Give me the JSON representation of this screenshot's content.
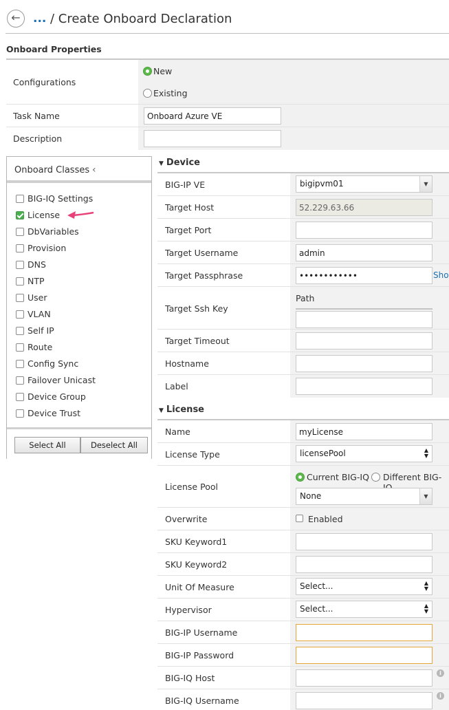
{
  "header": {
    "breadcrumb_ellipsis": "...",
    "title": "/ Create Onboard Declaration"
  },
  "onboard_properties": {
    "section_title": "Onboard Properties",
    "configurations_label": "Configurations",
    "config_options": [
      "New",
      "Existing"
    ],
    "config_selected": "New",
    "task_name_label": "Task Name",
    "task_name_value": "Onboard Azure VE",
    "description_label": "Description",
    "description_value": ""
  },
  "onboard_classes": {
    "title": "Onboard Classes",
    "items": [
      {
        "label": "BIG-IQ Settings",
        "checked": false
      },
      {
        "label": "License",
        "checked": true
      },
      {
        "label": "DbVariables",
        "checked": false
      },
      {
        "label": "Provision",
        "checked": false
      },
      {
        "label": "DNS",
        "checked": false
      },
      {
        "label": "NTP",
        "checked": false
      },
      {
        "label": "User",
        "checked": false
      },
      {
        "label": "VLAN",
        "checked": false
      },
      {
        "label": "Self IP",
        "checked": false
      },
      {
        "label": "Route",
        "checked": false
      },
      {
        "label": "Config Sync",
        "checked": false
      },
      {
        "label": "Failover Unicast",
        "checked": false
      },
      {
        "label": "Device Group",
        "checked": false
      },
      {
        "label": "Device Trust",
        "checked": false
      }
    ],
    "select_all_label": "Select All",
    "deselect_all_label": "Deselect All",
    "pointer_color": "#e8407a"
  },
  "device": {
    "section_title": "Device",
    "bigip_ve_label": "BIG-IP VE",
    "bigip_ve_value": "bigipvm01",
    "target_host_label": "Target Host",
    "target_host_value": "52.229.63.66",
    "target_port_label": "Target Port",
    "target_port_value": "",
    "target_username_label": "Target Username",
    "target_username_value": "admin",
    "target_passphrase_label": "Target Passphrase",
    "target_passphrase_value": "••••••••••••",
    "show_label": "Show",
    "target_ssh_key_label": "Target Ssh Key",
    "path_label": "Path",
    "target_timeout_label": "Target Timeout",
    "hostname_label": "Hostname",
    "label_label": "Label"
  },
  "license": {
    "section_title": "License",
    "name_label": "Name",
    "name_value": "myLicense",
    "license_type_label": "License Type",
    "license_type_value": "licensePool",
    "license_pool_label": "License Pool",
    "pool_options": [
      "Current BIG-IQ",
      "Different BIG-IQ"
    ],
    "pool_selected": "Current BIG-IQ",
    "pool_value": "None",
    "overwrite_label": "Overwrite",
    "overwrite_option": "Enabled",
    "sku_keyword1_label": "SKU Keyword1",
    "sku_keyword2_label": "SKU Keyword2",
    "unit_of_measure_label": "Unit Of Measure",
    "unit_of_measure_value": "Select...",
    "hypervisor_label": "Hypervisor",
    "hypervisor_value": "Select...",
    "bigip_username_label": "BIG-IP Username",
    "bigip_password_label": "BIG-IP Password",
    "bigiq_host_label": "BIG-IQ Host",
    "bigiq_username_label": "BIG-IQ Username"
  },
  "colors": {
    "link_blue": "#1a6fb0",
    "checked_green": "#4caf50",
    "required_border": "#e5a53b"
  }
}
